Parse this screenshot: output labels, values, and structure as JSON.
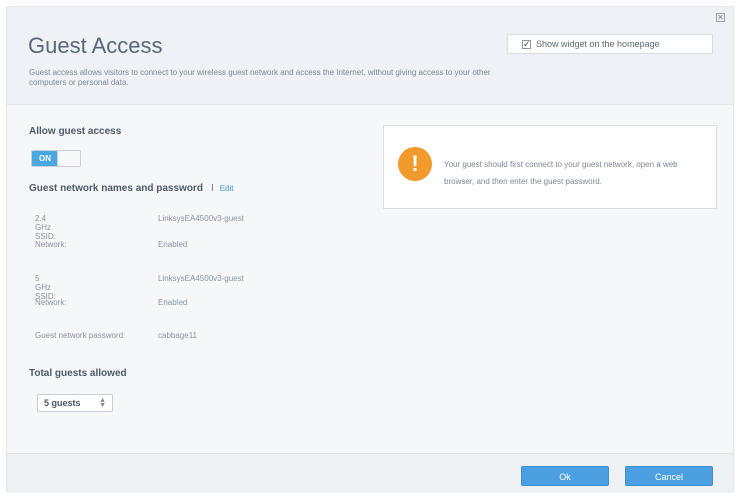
{
  "header": {
    "title": "Guest Access",
    "description": "Guest access allows visitors to connect to your wireless guest network and access the Internet, without giving access to your other computers or personal data.",
    "widget_label": "Show widget on the homepage",
    "close_symbol": "✕"
  },
  "access": {
    "label": "Allow guest access",
    "toggle_state": "ON"
  },
  "network": {
    "section_title": "Guest network names and password",
    "separator": "I",
    "edit_label": "Edit",
    "rows": [
      {
        "label": "2.4 GHz SSID:",
        "value": "LinksysEA4500v3-guest"
      },
      {
        "label": "Network:",
        "value": "Enabled"
      },
      {
        "label": "5 GHz SSID:",
        "value": "LinksysEA4500v3-guest"
      },
      {
        "label": "Network:",
        "value": "Enabled"
      },
      {
        "label": "Guest network password:",
        "value": "cabbage11"
      }
    ]
  },
  "guests": {
    "label": "Total guests allowed",
    "selected": "5 guests"
  },
  "alert": {
    "icon_symbol": "!",
    "text": "Your guest should first connect to your guest network, open a web browser, and then enter the guest password."
  },
  "footer": {
    "ok_label": "Ok",
    "cancel_label": "Cancel"
  },
  "colors": {
    "accent": "#4c9fe0",
    "warning": "#f39a2c"
  }
}
